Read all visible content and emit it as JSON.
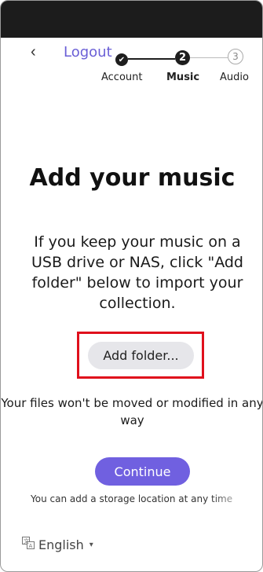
{
  "header": {
    "back_glyph": "‹",
    "logout_label": "Logout"
  },
  "stepper": {
    "steps": [
      {
        "label": "Account",
        "state": "done",
        "marker": "✔"
      },
      {
        "label": "Music",
        "state": "active",
        "marker": "2"
      },
      {
        "label": "Audio",
        "state": "upcoming",
        "marker": "3"
      }
    ]
  },
  "main": {
    "title": "Add your music",
    "description": "If you keep your music on a USB drive or NAS, click \"Add folder\" below to import your collection.",
    "add_folder_label": "Add folder...",
    "note": "Your files won't be moved or modified in any way",
    "continue_label": "Continue",
    "footnote": "You can add a storage location at any time"
  },
  "footer": {
    "language_label": "English",
    "language_icon": "translate-icon",
    "caret_glyph": "▾"
  },
  "colors": {
    "accent": "#7060e0",
    "link": "#6a5fd6",
    "highlight_border": "#e0101c",
    "topbar": "#1c1c1c"
  }
}
